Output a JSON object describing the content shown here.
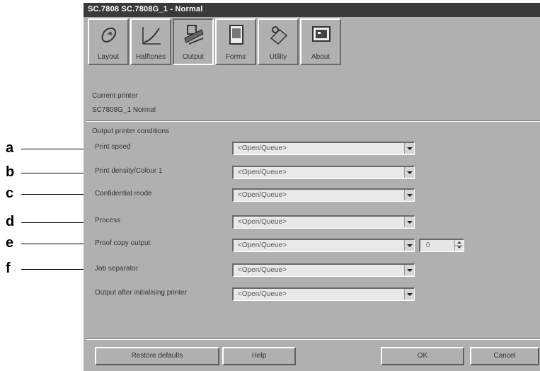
{
  "callouts": [
    "a",
    "b",
    "c",
    "d",
    "e",
    "f"
  ],
  "window": {
    "title": "SC.7808 SC.7808G_1 - Normal"
  },
  "tabs": [
    {
      "label": "Layout",
      "icon": "layout-icon"
    },
    {
      "label": "Halftones",
      "icon": "halftone-curve-icon"
    },
    {
      "label": "Output",
      "icon": "output-icon",
      "active": true
    },
    {
      "label": "Forms",
      "icon": "forms-icon"
    },
    {
      "label": "Utility",
      "icon": "utility-icon"
    },
    {
      "label": "About",
      "icon": "about-icon"
    }
  ],
  "current_printer": {
    "label": "Current printer",
    "value": "SC7808G_1 Normal"
  },
  "output_section": {
    "label": "Output printer conditions"
  },
  "rows": [
    {
      "label": "Print speed",
      "value": "<Open/Queue>"
    },
    {
      "label": "Print density/Colour 1",
      "value": "<Open/Queue>"
    },
    {
      "label": "Confidential mode",
      "value": "<Open/Queue>"
    },
    {
      "label": "Process",
      "value": "<Open/Queue>"
    },
    {
      "label": "Proof copy output",
      "value": "<Open/Queue>"
    },
    {
      "label": "Job separator",
      "value": "<Open/Queue>"
    },
    {
      "label": "Output after initialising printer",
      "value": "<Open/Queue>"
    }
  ],
  "proof_copies": "0",
  "buttons": {
    "restore": "Restore defaults",
    "help": "Help",
    "ok": "OK",
    "cancel": "Cancel"
  }
}
